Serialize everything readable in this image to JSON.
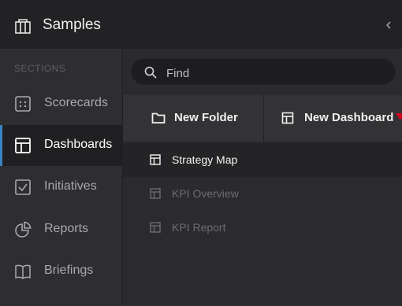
{
  "header": {
    "title": "Samples"
  },
  "sidebar": {
    "sections_label": "SECTIONS",
    "active_index": 1,
    "items": [
      {
        "label": "Scorecards",
        "icon": "scorecard-icon"
      },
      {
        "label": "Dashboards",
        "icon": "dashboard-icon"
      },
      {
        "label": "Initiatives",
        "icon": "checkbox-icon"
      },
      {
        "label": "Reports",
        "icon": "pie-chart-icon"
      },
      {
        "label": "Briefings",
        "icon": "book-icon"
      }
    ]
  },
  "search": {
    "placeholder": "Find",
    "value": ""
  },
  "toolbar": {
    "new_folder_label": "New Folder",
    "new_dashboard_label": "New Dashboard"
  },
  "list": {
    "items": [
      {
        "label": "Strategy Map",
        "selected": true
      },
      {
        "label": "KPI Overview",
        "selected": false
      },
      {
        "label": "KPI Report",
        "selected": false
      }
    ]
  },
  "colors": {
    "accent": "#3b82c4",
    "marker": "#d0021b",
    "background": "#2b2b2d",
    "sidebar": "#2e2e30",
    "active_item": "#202022"
  }
}
